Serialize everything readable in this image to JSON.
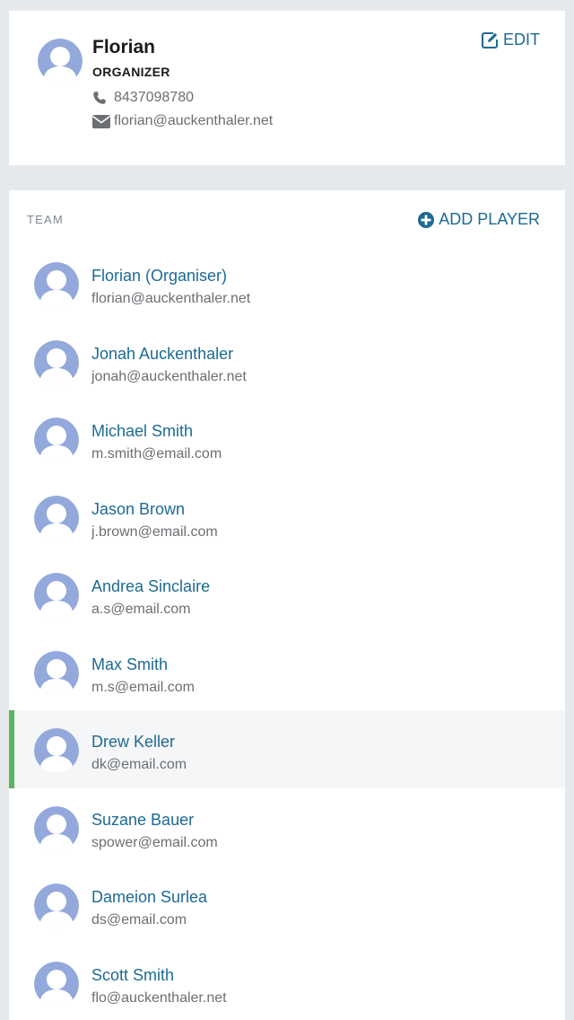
{
  "profile": {
    "name": "Florian",
    "role": "ORGANIZER",
    "phone": "8437098780",
    "email": "florian@auckenthaler.net",
    "edit_label": "EDIT",
    "icons": {
      "avatar": "user-avatar-icon",
      "phone": "phone-icon",
      "email": "envelope-icon",
      "edit": "edit-icon"
    }
  },
  "team": {
    "section_label": "TEAM",
    "add_player_label": "ADD PLAYER",
    "players": [
      {
        "name": "Florian (Organiser)",
        "email": "florian@auckenthaler.net",
        "selected": false
      },
      {
        "name": "Jonah Auckenthaler",
        "email": "jonah@auckenthaler.net",
        "selected": false
      },
      {
        "name": "Michael Smith",
        "email": "m.smith@email.com",
        "selected": false
      },
      {
        "name": "Jason Brown",
        "email": "j.brown@email.com",
        "selected": false
      },
      {
        "name": "Andrea Sinclaire",
        "email": "a.s@email.com",
        "selected": false
      },
      {
        "name": "Max Smith",
        "email": "m.s@email.com",
        "selected": false
      },
      {
        "name": "Drew Keller",
        "email": "dk@email.com",
        "selected": true
      },
      {
        "name": "Suzane Bauer",
        "email": "spower@email.com",
        "selected": false
      },
      {
        "name": "Dameion Surlea",
        "email": "ds@email.com",
        "selected": false
      },
      {
        "name": "Scott Smith",
        "email": "flo@auckenthaler.net",
        "selected": false
      }
    ]
  },
  "colors": {
    "accent": "#1d6a93",
    "selected_bar": "#5cb55f",
    "avatar": "#93a9dc",
    "background": "#e6e9ec"
  }
}
